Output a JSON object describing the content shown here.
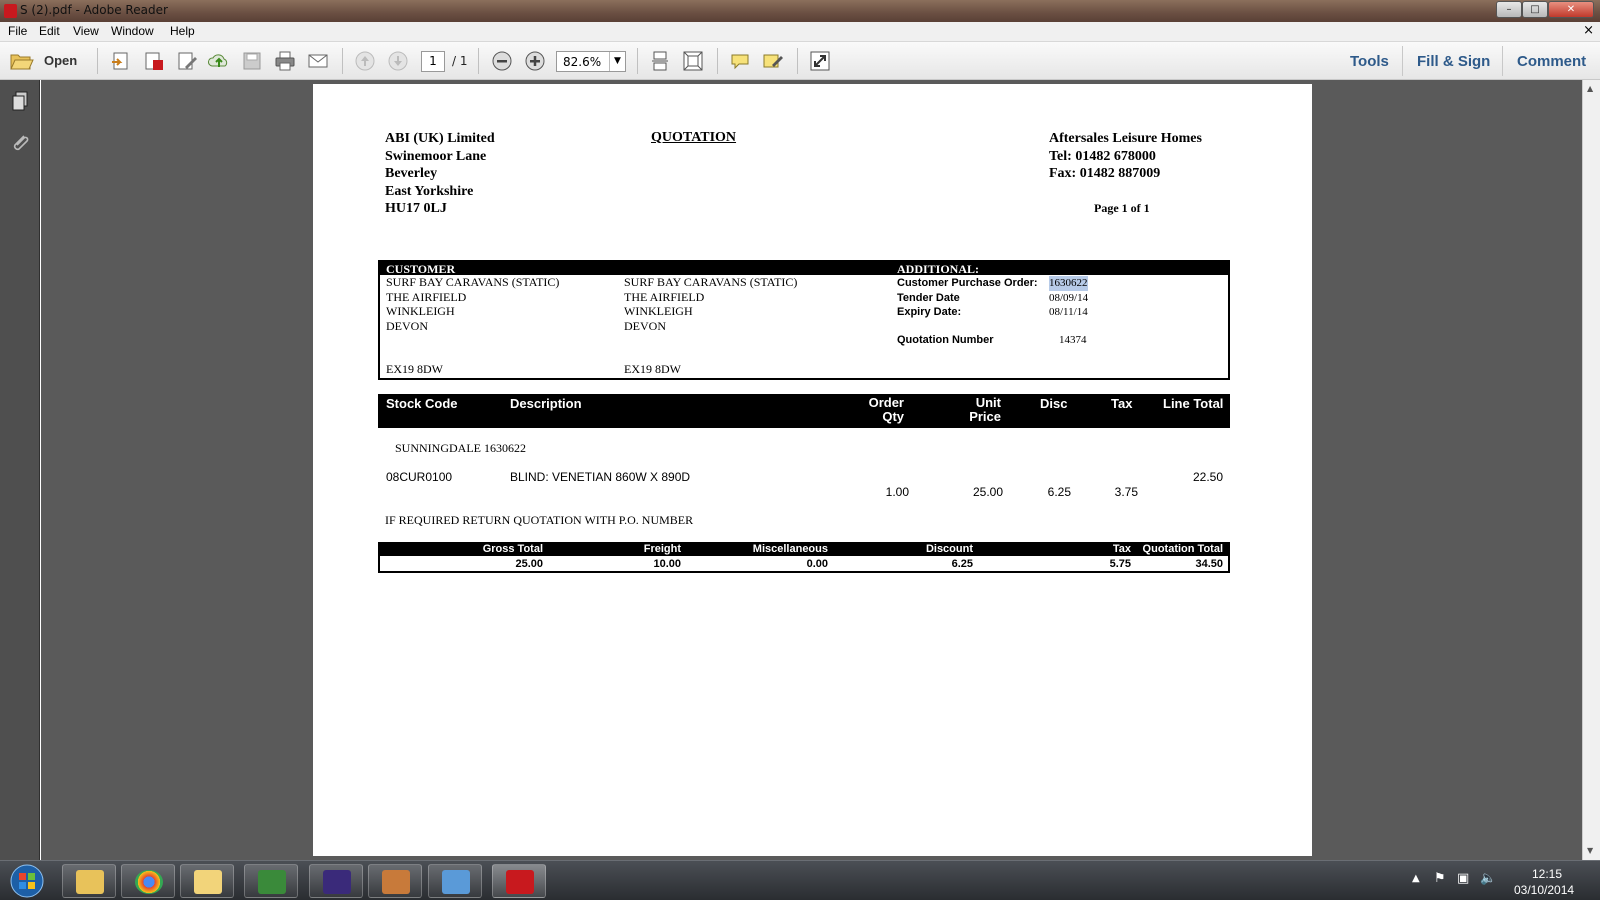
{
  "window": {
    "title": "S (2).pdf - Adobe Reader",
    "min": "–",
    "max": "□",
    "close": "✕"
  },
  "menu": {
    "items": [
      "File",
      "Edit",
      "View",
      "Window",
      "Help"
    ],
    "close_doc": "×"
  },
  "toolbar": {
    "open_label": "Open",
    "page_current": "1",
    "page_total": "/ 1",
    "zoom": "82.6%",
    "tools": "Tools",
    "fill_sign": "Fill & Sign",
    "comment": "Comment"
  },
  "document": {
    "supplier": {
      "name": "ABI (UK) Limited",
      "line1": "Swinemoor Lane",
      "line2": "Beverley",
      "line3": "East Yorkshire",
      "postcode": "HU17 0LJ"
    },
    "heading": "QUOTATION",
    "contact": {
      "name": "Aftersales Leisure Homes",
      "tel": "Tel: 01482 678000",
      "fax": "Fax: 01482 887009",
      "page": "Page 1 of 1"
    },
    "customer_header": "CUSTOMER",
    "additional_header": "ADDITIONAL:",
    "customer_address": [
      "SURF BAY CARAVANS (STATIC)",
      "THE AIRFIELD",
      "WINKLEIGH",
      "DEVON",
      "EX19 8DW"
    ],
    "delivery_address": [
      "SURF BAY CARAVANS (STATIC)",
      "THE AIRFIELD",
      "WINKLEIGH",
      "DEVON",
      "EX19 8DW"
    ],
    "additional": {
      "po_label": "Customer Purchase Order:",
      "po_value": "1630622",
      "tender_label": "Tender Date",
      "tender_value": "08/09/14",
      "expiry_label": "Expiry Date:",
      "expiry_value": "08/11/14",
      "quote_label": "Quotation Number",
      "quote_value": "14374"
    },
    "lines_header": {
      "stock_code": "Stock Code",
      "description": "Description",
      "order_qty_1": "Order",
      "order_qty_2": "Qty",
      "unit_price_1": "Unit",
      "unit_price_2": "Price",
      "disc": "Disc",
      "tax": "Tax",
      "line_total": "Line Total"
    },
    "reference": "SUNNINGDALE 1630622",
    "line": {
      "stock_code": "08CUR0100",
      "description": "BLIND: VENETIAN 860W X 890D",
      "qty": "1.00",
      "unit_price": "25.00",
      "disc": "6.25",
      "tax": "3.75",
      "line_total": "22.50"
    },
    "note": "IF REQUIRED RETURN QUOTATION WITH P.O. NUMBER",
    "totals": {
      "gross_label": "Gross Total",
      "gross": "25.00",
      "freight_label": "Freight",
      "freight": "10.00",
      "misc_label": "Miscellaneous",
      "misc": "0.00",
      "discount_label": "Discount",
      "discount": "6.25",
      "tax_label": "Tax",
      "tax": "5.75",
      "total_label": "Quotation Total",
      "total": "34.50"
    }
  },
  "taskbar": {
    "time": "12:15",
    "date": "03/10/2014"
  },
  "colors": {
    "accent": "#2e5a8a",
    "selection": "#b7cbe8",
    "pdf_red": "#c8191e"
  }
}
